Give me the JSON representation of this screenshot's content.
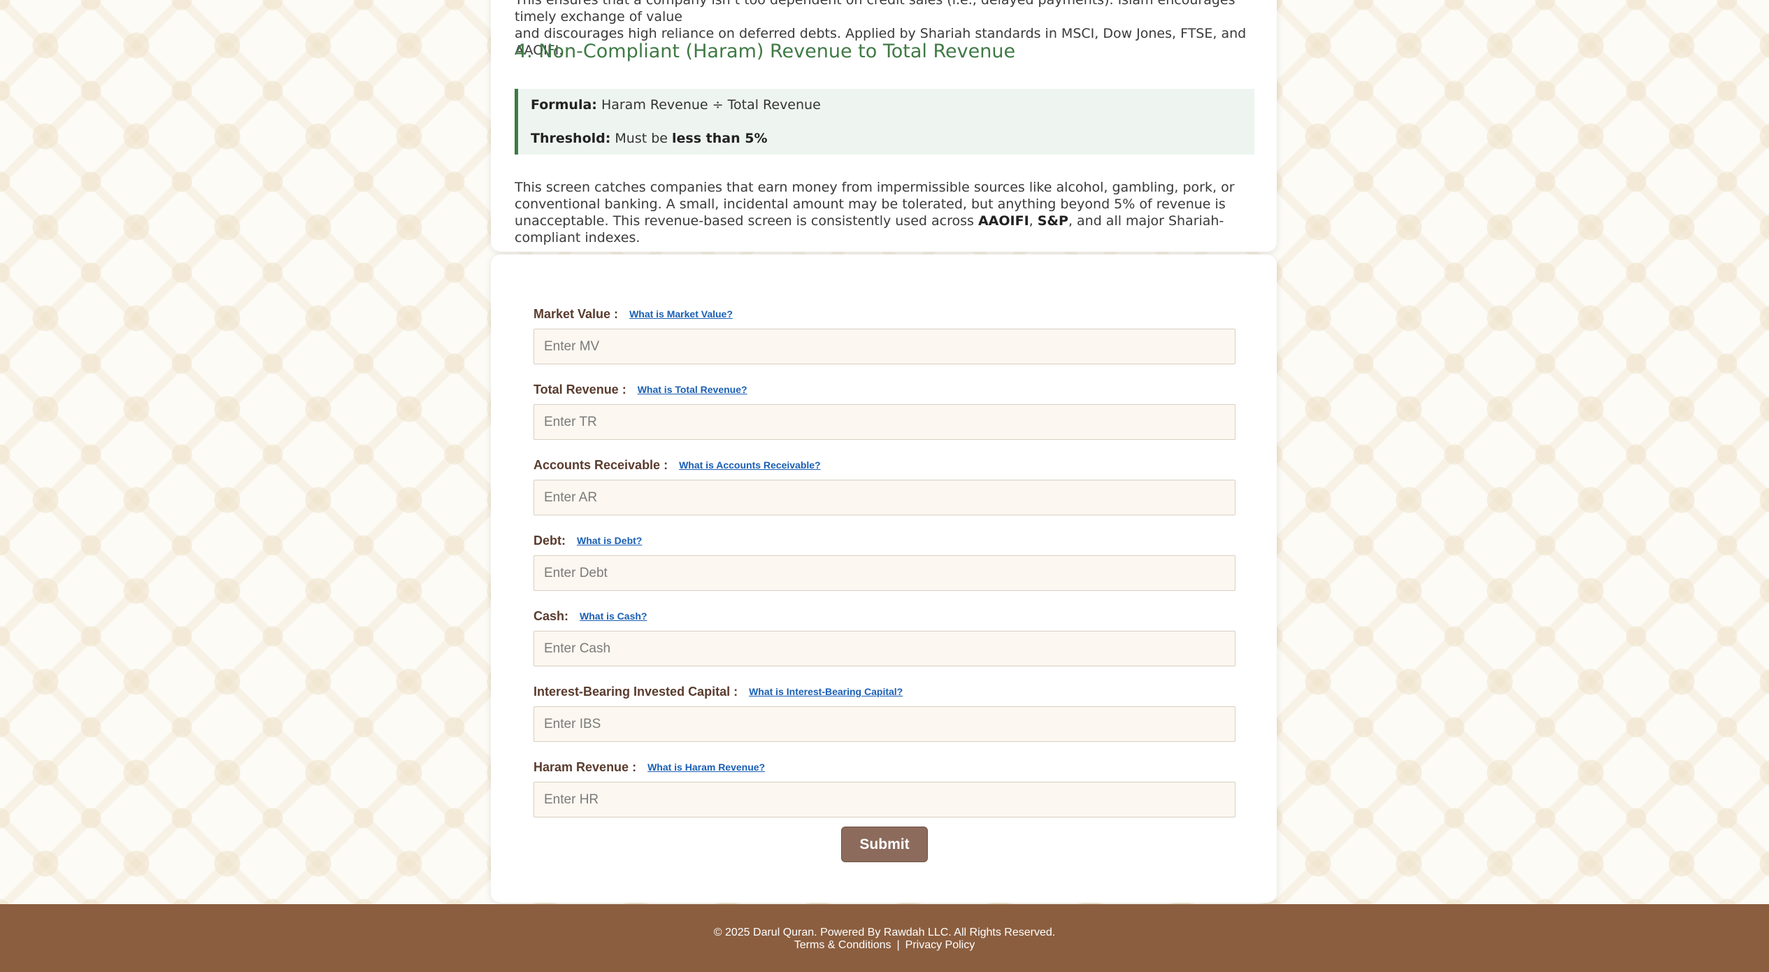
{
  "article": {
    "intro_line1": "This ensures that a company isn’t too dependent on credit sales (i.e., delayed payments). Islam encourages timely exchange of value",
    "intro_line2": "and discourages high reliance on deferred debts. Applied by Shariah standards in MSCI, Dow Jones, FTSE, and AAOIFI.",
    "section_heading": "4. Non-Compliant (Haram) Revenue to Total Revenue",
    "formula_label": "Formula:",
    "formula_value": "Haram Revenue ÷ Total Revenue",
    "threshold_label": "Threshold:",
    "threshold_prefix": "Must be",
    "threshold_value": "less than 5%",
    "paragraph_text": "This screen catches companies that earn money from impermissible sources like alcohol, gambling, pork, or conventional banking. A small, incidental amount may be tolerated, but anything beyond 5% of revenue is unacceptable. This revenue-based screen is consistently used across",
    "paragraph_bold_1": "AAOIFI",
    "paragraph_sep": ",",
    "paragraph_bold_2": "S&P",
    "paragraph_end": ", and all major Shariah-compliant indexes."
  },
  "form": {
    "fields": [
      {
        "label": "Market Value :",
        "help": "What is Market Value?",
        "placeholder": "Enter MV",
        "value": ""
      },
      {
        "label": "Total Revenue :",
        "help": "What is Total Revenue?",
        "placeholder": "Enter TR",
        "value": ""
      },
      {
        "label": "Accounts Receivable :",
        "help": "What is Accounts Receivable?",
        "placeholder": "Enter AR",
        "value": ""
      },
      {
        "label": "Debt:",
        "help": "What is Debt?",
        "placeholder": "Enter Debt",
        "value": ""
      },
      {
        "label": "Cash:",
        "help": "What is Cash?",
        "placeholder": "Enter Cash",
        "value": ""
      },
      {
        "label": "Interest-Bearing Invested Capital :",
        "help": "What is Interest-Bearing Capital?",
        "placeholder": "Enter IBS",
        "value": ""
      },
      {
        "label": "Haram Revenue :",
        "help": "What is Haram Revenue?",
        "placeholder": "Enter HR",
        "value": ""
      }
    ],
    "submit_label": "Submit"
  },
  "footer": {
    "copyright": "© 2025 Darul Quran. Powered By Rawdah LLC. All Rights Reserved.",
    "terms": "Terms & Conditions",
    "separator": "|",
    "privacy": "Privacy Policy"
  },
  "colors": {
    "heading_green": "#3f7a45",
    "label_brown": "#5a3c2e",
    "link_blue": "#1a5fb4",
    "submit_bg": "#8c6b5c",
    "footer_bg": "#8b5e3f",
    "input_bg": "#fcf7f0"
  }
}
